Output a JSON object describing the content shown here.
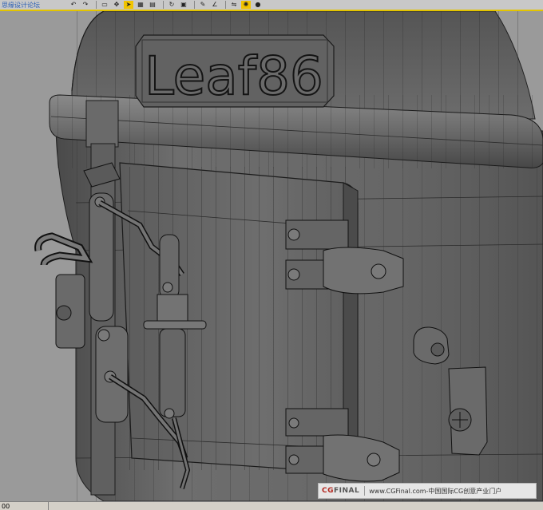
{
  "toolbar": {
    "watermark": "思缘设计论坛",
    "buttons": [
      {
        "name": "undo-icon",
        "glyph": "↶"
      },
      {
        "name": "redo-icon",
        "glyph": "↷"
      },
      {
        "name": "select-icon",
        "glyph": "▭"
      },
      {
        "name": "move-icon",
        "glyph": "✥"
      },
      {
        "name": "pointer-icon",
        "glyph": "➤"
      },
      {
        "name": "region-icon",
        "glyph": "▦"
      },
      {
        "name": "filter-icon",
        "glyph": "▤"
      },
      {
        "name": "rotate-icon",
        "glyph": "↻"
      },
      {
        "name": "scale-icon",
        "glyph": "▣"
      },
      {
        "name": "snap-icon",
        "glyph": "✎"
      },
      {
        "name": "angle-snap-icon",
        "glyph": "∠"
      },
      {
        "name": "mirror-icon",
        "glyph": "⇋"
      },
      {
        "name": "render-icon",
        "glyph": "✺"
      },
      {
        "name": "material-icon",
        "glyph": "●"
      }
    ]
  },
  "viewport": {
    "nameplate_text": "Leaf86"
  },
  "banner": {
    "brand_prefix": "CG",
    "brand_rest": "FINAL",
    "text": "www.CGFinal.com-中国国际CG创意产业门户"
  },
  "statusbar": {
    "frame": "00"
  }
}
